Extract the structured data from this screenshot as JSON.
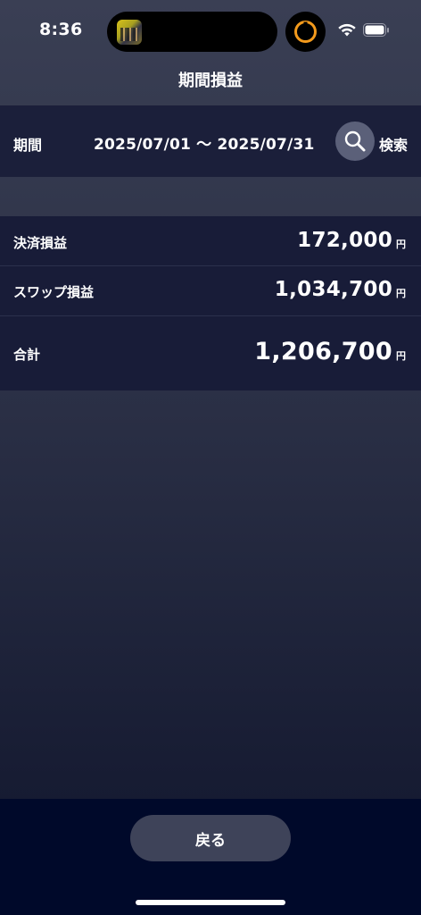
{
  "status_bar": {
    "time": "8:36"
  },
  "nav": {
    "title": "期間損益"
  },
  "period": {
    "label": "期間",
    "range": "2025/07/01 〜 2025/07/31",
    "search_label": "検索"
  },
  "results": [
    {
      "label": "決済損益",
      "value": "172,000",
      "unit": "円"
    },
    {
      "label": "スワップ損益",
      "value": "1,034,700",
      "unit": "円"
    },
    {
      "label": "合計",
      "value": "1,206,700",
      "unit": "円"
    }
  ],
  "footer": {
    "back_label": "戻る"
  },
  "colors": {
    "timer_accent": "#f39a1c",
    "panel_bg": "#181c38",
    "bottom_bar_bg": "#00092a"
  }
}
